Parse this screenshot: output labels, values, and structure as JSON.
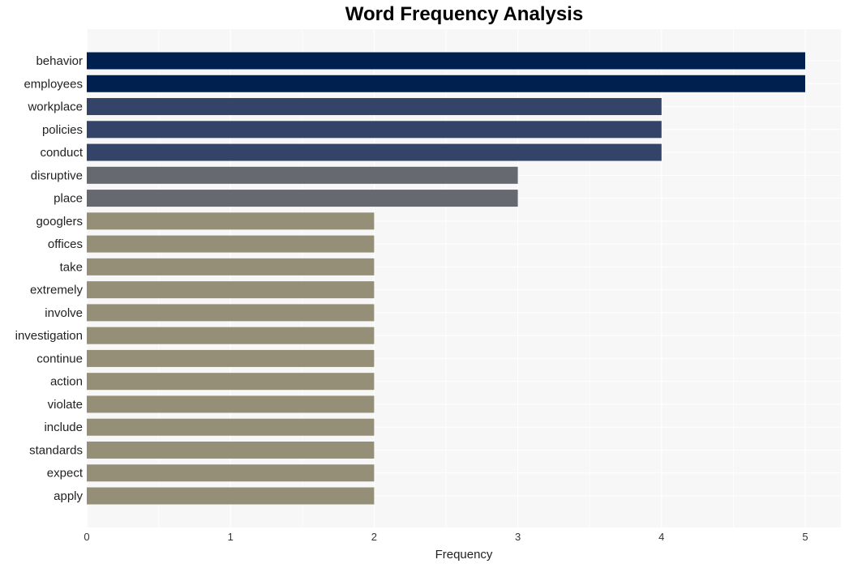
{
  "chart_data": {
    "type": "bar",
    "orientation": "horizontal",
    "title": "Word Frequency Analysis",
    "xlabel": "Frequency",
    "ylabel": "",
    "xlim": [
      0,
      5.25
    ],
    "xticks": [
      0,
      1,
      2,
      3,
      4,
      5
    ],
    "grid": true,
    "legend": "none",
    "categories": [
      "behavior",
      "employees",
      "workplace",
      "policies",
      "conduct",
      "disruptive",
      "place",
      "googlers",
      "offices",
      "take",
      "extremely",
      "involve",
      "investigation",
      "continue",
      "action",
      "violate",
      "include",
      "standards",
      "expect",
      "apply"
    ],
    "values": [
      5,
      5,
      4,
      4,
      4,
      3,
      3,
      2,
      2,
      2,
      2,
      2,
      2,
      2,
      2,
      2,
      2,
      2,
      2,
      2
    ],
    "colors": {
      "5": "#00204f",
      "4": "#344469",
      "3": "#676970",
      "2": "#958f78"
    },
    "plot_background": "#f7f7f7",
    "grid_color": "#ffffff"
  }
}
